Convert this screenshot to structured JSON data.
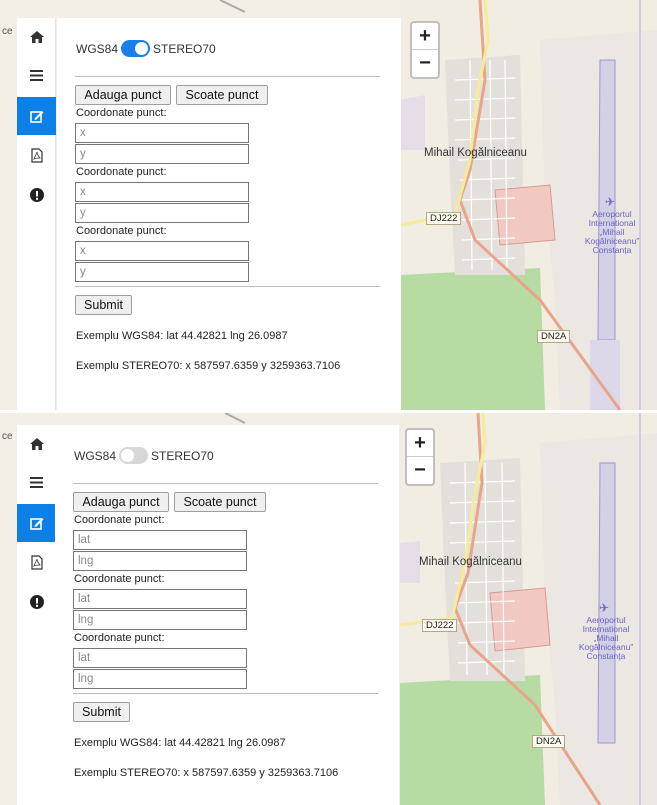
{
  "shots": [
    {
      "projection": {
        "left": "WGS84",
        "right": "STEREO70",
        "toggle_state": "on"
      },
      "buttons": {
        "add": "Adauga punct",
        "remove": "Scoate punct",
        "submit": "Submit"
      },
      "points": [
        {
          "label": "Coordonate punct:",
          "x_placeholder": "x",
          "y_placeholder": "y"
        },
        {
          "label": "Coordonate punct:",
          "x_placeholder": "x",
          "y_placeholder": "y"
        },
        {
          "label": "Coordonate punct:",
          "x_placeholder": "x",
          "y_placeholder": "y"
        }
      ],
      "examples": {
        "wgs84": "Exemplu WGS84: lat 44.42821 lng 26.0987",
        "stereo70": "Exemplu STEREO70: x 587597.6359 y 3259363.7106"
      }
    },
    {
      "projection": {
        "left": "WGS84",
        "right": "STEREO70",
        "toggle_state": "off"
      },
      "buttons": {
        "add": "Adauga punct",
        "remove": "Scoate punct",
        "submit": "Submit"
      },
      "points": [
        {
          "label": "Coordonate punct:",
          "x_placeholder": "lat",
          "y_placeholder": "lng"
        },
        {
          "label": "Coordonate punct:",
          "x_placeholder": "lat",
          "y_placeholder": "lng"
        },
        {
          "label": "Coordonate punct:",
          "x_placeholder": "lat",
          "y_placeholder": "lng"
        }
      ],
      "examples": {
        "wgs84": "Exemplu WGS84: lat 44.42821 lng 26.0987",
        "stereo70": "Exemplu STEREO70: x 587597.6359 y 3259363.7106"
      }
    }
  ],
  "sidebar_icons": [
    "home-icon",
    "menu-icon",
    "edit-icon",
    "pdf-icon",
    "info-icon"
  ],
  "map": {
    "zoom_in": "+",
    "zoom_out": "−",
    "town_label": "Mihail Kogălniceanu",
    "road_dj222": "DJ222",
    "road_dn2a": "DN2A",
    "airport_lines": [
      "Aeroportul",
      "International",
      "„Mihail",
      "Kogălniceanu”",
      "Constanța"
    ],
    "edge_text": "ce"
  },
  "colors": {
    "accent": "#0c80e6",
    "toggle_on": "#1a7fe8",
    "forest": "#b6dba3",
    "road_orange": "#e9a48a",
    "airport": "#6c63c7"
  }
}
